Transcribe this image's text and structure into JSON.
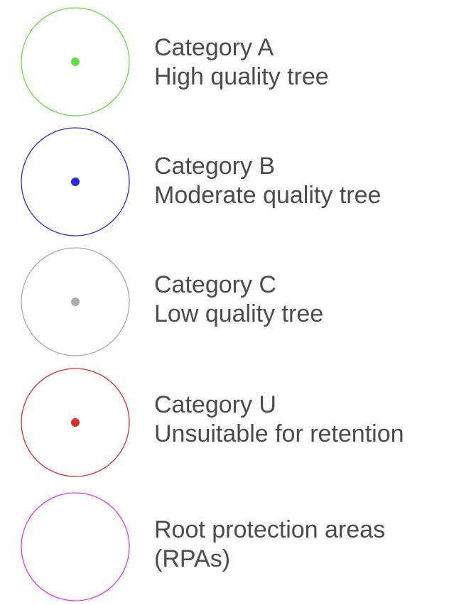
{
  "legend": {
    "items": [
      {
        "title": "Category A",
        "description": "High quality tree",
        "color": "#66dd44",
        "dot": true
      },
      {
        "title": "Category B",
        "description": "Moderate quality tree",
        "color": "#2b2bdd",
        "dot": true
      },
      {
        "title": "Category C",
        "description": "Low quality tree",
        "color": "#aaaaaa",
        "dot": true
      },
      {
        "title": "Category U",
        "description": "Unsuitable for retention",
        "color": "#dd2b2b",
        "dot": true
      },
      {
        "title": "Root protection areas",
        "description": "(RPAs)",
        "color": "#ee33ee",
        "dot": false
      }
    ]
  }
}
